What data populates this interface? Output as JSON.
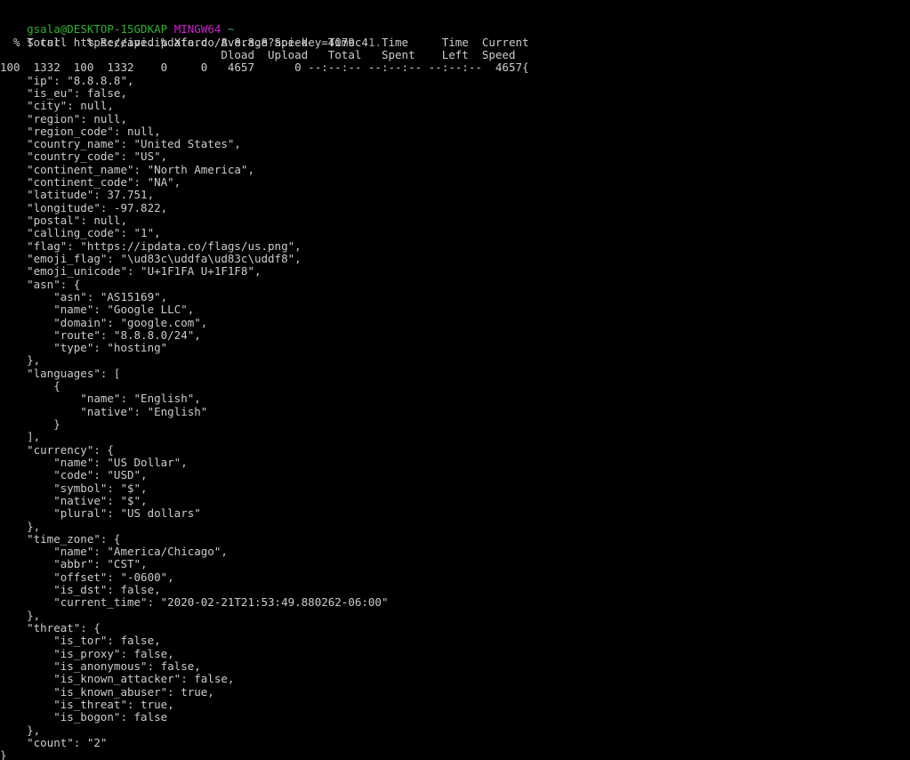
{
  "terminal": {
    "shell_name": "MINGW64",
    "background_color": "#000000",
    "foreground_color": "#cccccc",
    "prompt_user_color": "#2fb22f",
    "prompt_shell_color": "#cc22cc",
    "prompt_path_color": "#2aa198",
    "prompt": {
      "user_host": "gsala@DESKTOP-15GDKAP",
      "shell": "MINGW64",
      "path": "~"
    },
    "command_line": {
      "sigil": "$ ",
      "command": "curl https://api.ipdata.co/8.8.8.8?api-key=",
      "api_key_visible": "4079c4",
      "api_key_truncated_tail": "1..."
    },
    "curl_progress": {
      "header_line_1": "  % Total    % Received % Xferd  Average Speed   Time    Time     Time  Current",
      "header_line_2": "                                 Dload  Upload   Total   Spent    Left  Speed",
      "stats_line": "100  1332  100  1332    0     0   4657      0 --:--:-- --:--:-- --:--:--  4657{",
      "percent_total": "100",
      "total_bytes": "1332",
      "percent_received": "100",
      "received_bytes": "1332",
      "percent_xferd": "0",
      "xferd_bytes": "0",
      "dload_speed": "4657",
      "upload_speed": "0",
      "time_total": "--:--:--",
      "time_spent": "--:--:--",
      "time_left": "--:--:--",
      "current_speed": "4657"
    },
    "response_lines": [
      "    \"ip\": \"8.8.8.8\",",
      "    \"is_eu\": false,",
      "    \"city\": null,",
      "    \"region\": null,",
      "    \"region_code\": null,",
      "    \"country_name\": \"United States\",",
      "    \"country_code\": \"US\",",
      "    \"continent_name\": \"North America\",",
      "    \"continent_code\": \"NA\",",
      "    \"latitude\": 37.751,",
      "    \"longitude\": -97.822,",
      "    \"postal\": null,",
      "    \"calling_code\": \"1\",",
      "    \"flag\": \"https://ipdata.co/flags/us.png\",",
      "    \"emoji_flag\": \"\\ud83c\\uddfa\\ud83c\\uddf8\",",
      "    \"emoji_unicode\": \"U+1F1FA U+1F1F8\",",
      "    \"asn\": {",
      "        \"asn\": \"AS15169\",",
      "        \"name\": \"Google LLC\",",
      "        \"domain\": \"google.com\",",
      "        \"route\": \"8.8.8.0/24\",",
      "        \"type\": \"hosting\"",
      "    },",
      "    \"languages\": [",
      "        {",
      "            \"name\": \"English\",",
      "            \"native\": \"English\"",
      "        }",
      "    ],",
      "    \"currency\": {",
      "        \"name\": \"US Dollar\",",
      "        \"code\": \"USD\",",
      "        \"symbol\": \"$\",",
      "        \"native\": \"$\",",
      "        \"plural\": \"US dollars\"",
      "    },",
      "    \"time_zone\": {",
      "        \"name\": \"America/Chicago\",",
      "        \"abbr\": \"CST\",",
      "        \"offset\": \"-0600\",",
      "        \"is_dst\": false,",
      "        \"current_time\": \"2020-02-21T21:53:49.880262-06:00\"",
      "    },",
      "    \"threat\": {",
      "        \"is_tor\": false,",
      "        \"is_proxy\": false,",
      "        \"is_anonymous\": false,",
      "        \"is_known_attacker\": false,",
      "        \"is_known_abuser\": true,",
      "        \"is_threat\": true,",
      "        \"is_bogon\": false",
      "    },",
      "    \"count\": \"2\"",
      "}"
    ],
    "response_values": {
      "ip": "8.8.8.8",
      "is_eu": "false",
      "city": "null",
      "region": "null",
      "region_code": "null",
      "country_name": "United States",
      "country_code": "US",
      "continent_name": "North America",
      "continent_code": "NA",
      "latitude": "37.751",
      "longitude": "-97.822",
      "postal": "null",
      "calling_code": "1",
      "flag": "https://ipdata.co/flags/us.png",
      "emoji_flag": "\\ud83c\\uddfa\\ud83c\\uddf8",
      "emoji_unicode": "U+1F1FA U+1F1F8",
      "asn_asn": "AS15169",
      "asn_name": "Google LLC",
      "asn_domain": "google.com",
      "asn_route": "8.8.8.0/24",
      "asn_type": "hosting",
      "language_name": "English",
      "language_native": "English",
      "currency_name": "US Dollar",
      "currency_code": "USD",
      "currency_symbol": "$",
      "currency_native": "$",
      "currency_plural": "US dollars",
      "time_zone_name": "America/Chicago",
      "time_zone_abbr": "CST",
      "time_zone_offset": "-0600",
      "time_zone_is_dst": "false",
      "time_zone_current_time": "2020-02-21T21:53:49.880262-06:00",
      "threat_is_tor": "false",
      "threat_is_proxy": "false",
      "threat_is_anonymous": "false",
      "threat_is_known_attacker": "false",
      "threat_is_known_abuser": "true",
      "threat_is_threat": "true",
      "threat_is_bogon": "false",
      "count": "2"
    }
  }
}
